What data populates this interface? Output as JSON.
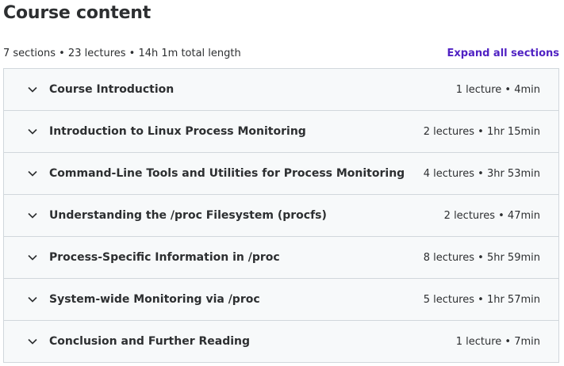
{
  "header": {
    "title": "Course content",
    "summary": "7 sections • 23 lectures • 14h 1m total length",
    "expand_label": "Expand all sections"
  },
  "sections": [
    {
      "title": "Course Introduction",
      "meta": "1 lecture • 4min"
    },
    {
      "title": "Introduction to Linux Process Monitoring",
      "meta": "2 lectures • 1hr 15min"
    },
    {
      "title": "Command-Line Tools and Utilities for Process Monitoring",
      "meta": "4 lectures • 3hr 53min"
    },
    {
      "title": "Understanding the /proc Filesystem (procfs)",
      "meta": "2 lectures • 47min"
    },
    {
      "title": "Process-Specific Information in /proc",
      "meta": "8 lectures • 5hr 59min"
    },
    {
      "title": "System-wide Monitoring via /proc",
      "meta": "5 lectures • 1hr 57min"
    },
    {
      "title": "Conclusion and Further Reading",
      "meta": "1 lecture • 7min"
    }
  ],
  "icons": {
    "section_toggle": "chevron-down-icon"
  },
  "colors": {
    "text": "#2d2f31",
    "link": "#5022c3",
    "border": "#d1d7dc",
    "section_bg": "#f7f9fa"
  }
}
